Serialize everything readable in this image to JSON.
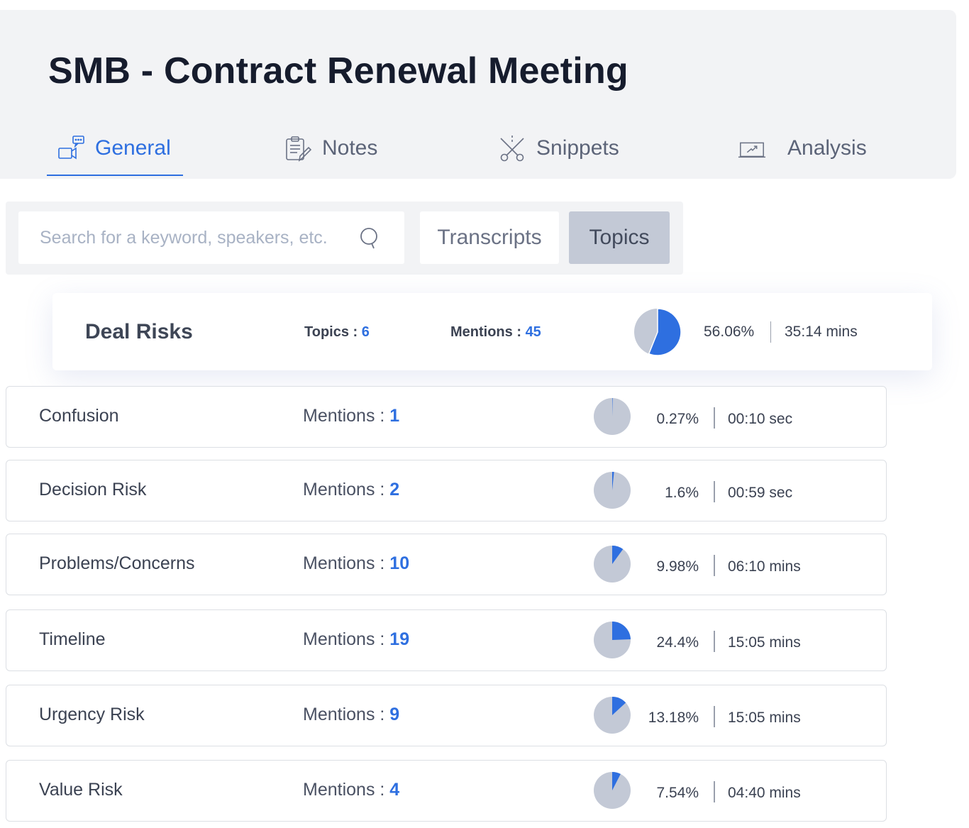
{
  "header": {
    "title": "SMB - Contract Renewal Meeting",
    "tabs": [
      {
        "label": "General",
        "icon": "video-chat-icon",
        "active": true
      },
      {
        "label": "Notes",
        "icon": "clipboard-edit-icon",
        "active": false
      },
      {
        "label": "Snippets",
        "icon": "scissors-icon",
        "active": false
      },
      {
        "label": "Analysis",
        "icon": "chart-trend-icon",
        "active": false
      }
    ]
  },
  "toolbar": {
    "search": {
      "value": "",
      "placeholder": "Search for a keyword, speakers, etc.",
      "icon": "search-icon"
    },
    "view_toggle": [
      {
        "label": "Transcripts",
        "selected": false
      },
      {
        "label": "Topics",
        "selected": true
      }
    ]
  },
  "colors": {
    "accent": "#2e6fe0",
    "pie_base": "#c3c9d6",
    "header_bg": "#f2f3f5",
    "title": "#161c2d"
  },
  "summary": {
    "name": "Deal Risks",
    "topics_label": "Topics :",
    "topics_value": "6",
    "mentions_label": "Mentions :",
    "mentions_value": "45",
    "percent": 56.06,
    "percent_text": "56.06%",
    "duration": "35:14 mins"
  },
  "topics": [
    {
      "name": "Confusion",
      "mentions_label": "Mentions :",
      "mentions": "1",
      "percent": 0.27,
      "percent_text": "0.27%",
      "duration": "00:10 sec"
    },
    {
      "name": "Decision Risk",
      "mentions_label": "Mentions :",
      "mentions": "2",
      "percent": 1.6,
      "percent_text": "1.6%",
      "duration": "00:59 sec"
    },
    {
      "name": "Problems/Concerns",
      "mentions_label": "Mentions :",
      "mentions": "10",
      "percent": 9.98,
      "percent_text": "9.98%",
      "duration": "06:10 mins"
    },
    {
      "name": "Timeline",
      "mentions_label": "Mentions :",
      "mentions": "19",
      "percent": 24.4,
      "percent_text": "24.4%",
      "duration": "15:05 mins"
    },
    {
      "name": "Urgency Risk",
      "mentions_label": "Mentions :",
      "mentions": "9",
      "percent": 13.18,
      "percent_text": "13.18%",
      "duration": "15:05 mins"
    },
    {
      "name": "Value Risk",
      "mentions_label": "Mentions :",
      "mentions": "4",
      "percent": 7.54,
      "percent_text": "7.54%",
      "duration": "04:40 mins"
    }
  ]
}
